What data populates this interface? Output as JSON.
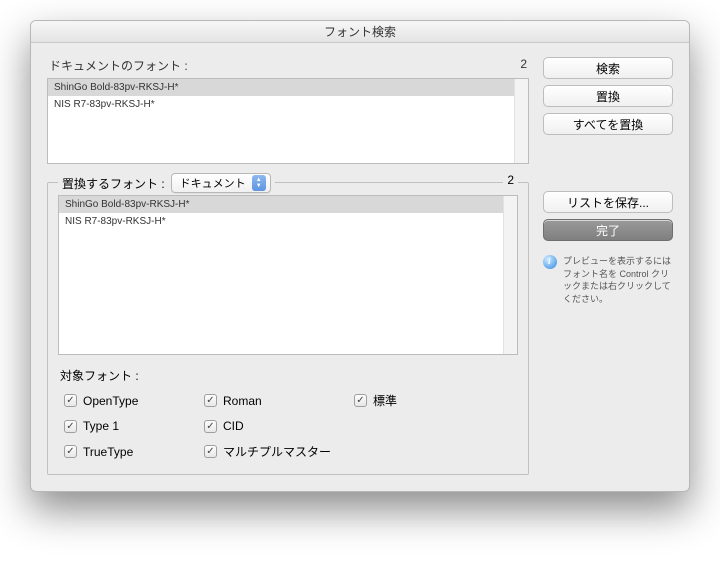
{
  "window": {
    "title": "フォント検索"
  },
  "documentFonts": {
    "label": "ドキュメントのフォント :",
    "count": "2",
    "items": [
      {
        "name": "ShinGo Bold-83pv-RKSJ-H*",
        "selected": true
      },
      {
        "name": "NIS R7-83pv-RKSJ-H*",
        "selected": false
      }
    ]
  },
  "replaceFonts": {
    "label": "置換するフォント :",
    "dropdown": {
      "value": "ドキュメント"
    },
    "count": "2",
    "items": [
      {
        "name": "ShinGo Bold-83pv-RKSJ-H*",
        "selected": true
      },
      {
        "name": "NIS R7-83pv-RKSJ-H*",
        "selected": false
      }
    ]
  },
  "targetFonts": {
    "label": "対象フォント :",
    "checks": [
      {
        "label": "OpenType",
        "checked": true
      },
      {
        "label": "Roman",
        "checked": true
      },
      {
        "label": "標準",
        "checked": true
      },
      {
        "label": "Type 1",
        "checked": true
      },
      {
        "label": "CID",
        "checked": true
      },
      {
        "label": "TrueType",
        "checked": true
      },
      {
        "label": "マルチプルマスター",
        "checked": true
      }
    ]
  },
  "buttons": {
    "find": "検索",
    "replace": "置換",
    "replaceAll": "すべてを置換",
    "saveList": "リストを保存...",
    "done": "完了"
  },
  "info": {
    "text": "プレビューを表示するにはフォント名を Control クリックまたは右クリックしてください。"
  }
}
